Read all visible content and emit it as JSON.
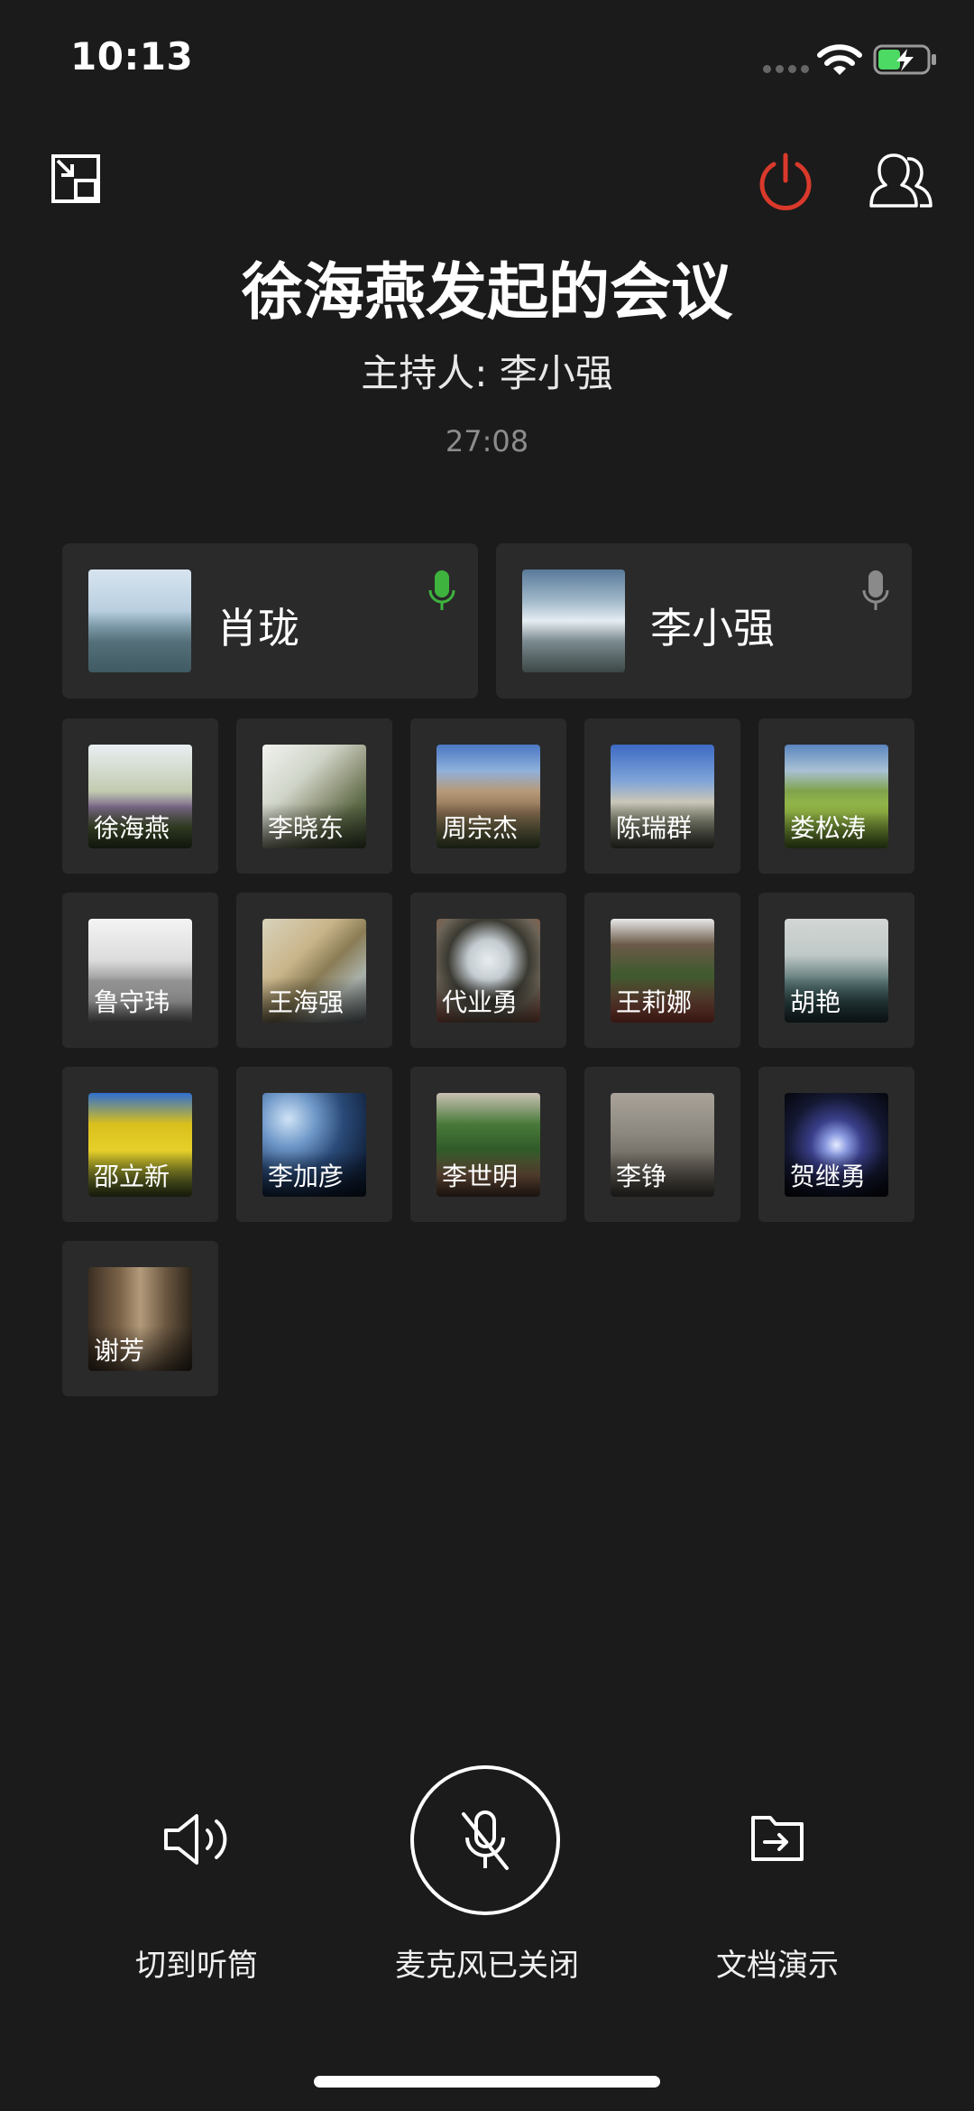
{
  "status_bar": {
    "time": "10:13"
  },
  "meeting": {
    "title": "徐海燕发起的会议",
    "host": "主持人: 李小强",
    "timer": "27:08"
  },
  "speakers": [
    {
      "name": "肖珑",
      "mic": "active",
      "mic_color": "#3eb33e"
    },
    {
      "name": "李小强",
      "mic": "idle",
      "mic_color": "#8a8a8a"
    }
  ],
  "participants": [
    {
      "name": "徐海燕"
    },
    {
      "name": "李晓东"
    },
    {
      "name": "周宗杰"
    },
    {
      "name": "陈瑞群"
    },
    {
      "name": "娄松涛"
    },
    {
      "name": "鲁守玮"
    },
    {
      "name": "王海强"
    },
    {
      "name": "代业勇"
    },
    {
      "name": "王莉娜"
    },
    {
      "name": "胡艳"
    },
    {
      "name": "邵立新"
    },
    {
      "name": "李加彦"
    },
    {
      "name": "李世明"
    },
    {
      "name": "李铮"
    },
    {
      "name": "贺继勇"
    },
    {
      "name": "谢芳"
    }
  ],
  "controls": {
    "speaker_label": "切到听筒",
    "mic_label": "麦克风已关闭",
    "doc_label": "文档演示"
  },
  "colors": {
    "background": "#1b1b1b",
    "tile": "#2a2a2a",
    "power": "#d9392b",
    "active_mic": "#3eb33e"
  }
}
